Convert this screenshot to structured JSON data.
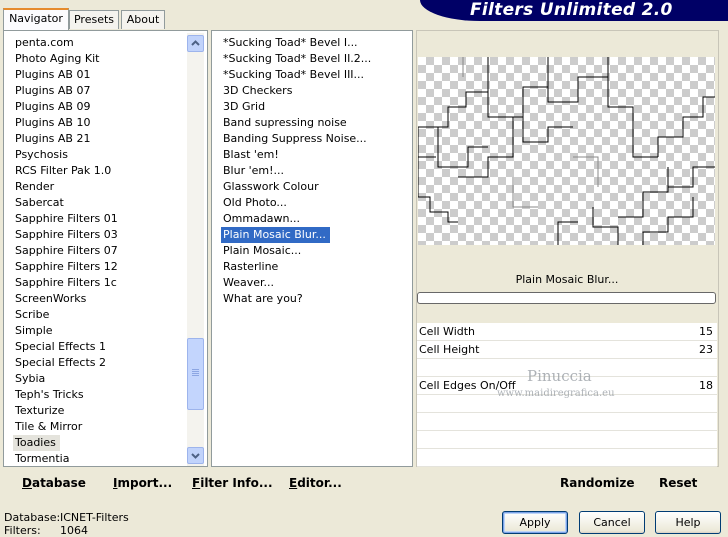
{
  "tabs": [
    "Navigator",
    "Presets",
    "About"
  ],
  "title": "Filters Unlimited 2.0",
  "categories": [
    "penta.com",
    "Photo Aging Kit",
    "Plugins AB 01",
    "Plugins AB 07",
    "Plugins AB 09",
    "Plugins AB 10",
    "Plugins AB 21",
    "Psychosis",
    "RCS Filter Pak 1.0",
    "Render",
    "Sabercat",
    "Sapphire Filters 01",
    "Sapphire Filters 03",
    "Sapphire Filters 07",
    "Sapphire Filters 12",
    "Sapphire Filters 1c",
    "ScreenWorks",
    "Scribe",
    "Simple",
    "Special Effects 1",
    "Special Effects 2",
    "Sybia",
    "Teph's Tricks",
    "Texturize",
    "Tile & Mirror",
    "Toadies",
    "Tormentia"
  ],
  "selected_category": "Toadies",
  "filters": [
    "*Sucking Toad*  Bevel I...",
    "*Sucking Toad*  Bevel II.2...",
    "*Sucking Toad*  Bevel III...",
    "3D Checkers",
    "3D Grid",
    "Band supressing noise",
    "Banding Suppress Noise...",
    "Blast 'em!",
    "Blur 'em!...",
    "Glasswork Colour",
    "Old Photo...",
    "Ommadawn...",
    "Plain Mosaic Blur...",
    "Plain Mosaic...",
    "Rasterline",
    "Weaver...",
    "What are you?"
  ],
  "selected_filter": "Plain Mosaic Blur...",
  "current_filter_name": "Plain Mosaic Blur...",
  "parameters": [
    {
      "label": "Cell Width",
      "value": "15"
    },
    {
      "label": "Cell Height",
      "value": "23"
    },
    {
      "label": "",
      "value": ""
    },
    {
      "label": "Cell Edges On/Off",
      "value": "18"
    }
  ],
  "watermark": {
    "name": "Pinuccia",
    "site": "www.maidiregrafica.eu"
  },
  "bottom_left_buttons": {
    "database": "Database",
    "import": "Import...",
    "filter_info": "Filter Info...",
    "editor": "Editor..."
  },
  "bottom_right_buttons": {
    "randomize": "Randomize",
    "reset": "Reset"
  },
  "status": {
    "database_label": "Database:",
    "database_value": "ICNET-Filters",
    "filters_label": "Filters:",
    "filters_value": "1064"
  },
  "dialog_buttons": {
    "apply": "Apply",
    "cancel": "Cancel",
    "help": "Help"
  },
  "colors": {
    "banner": "#000066",
    "selection": "#316ac5",
    "background": "#ece9d8"
  }
}
